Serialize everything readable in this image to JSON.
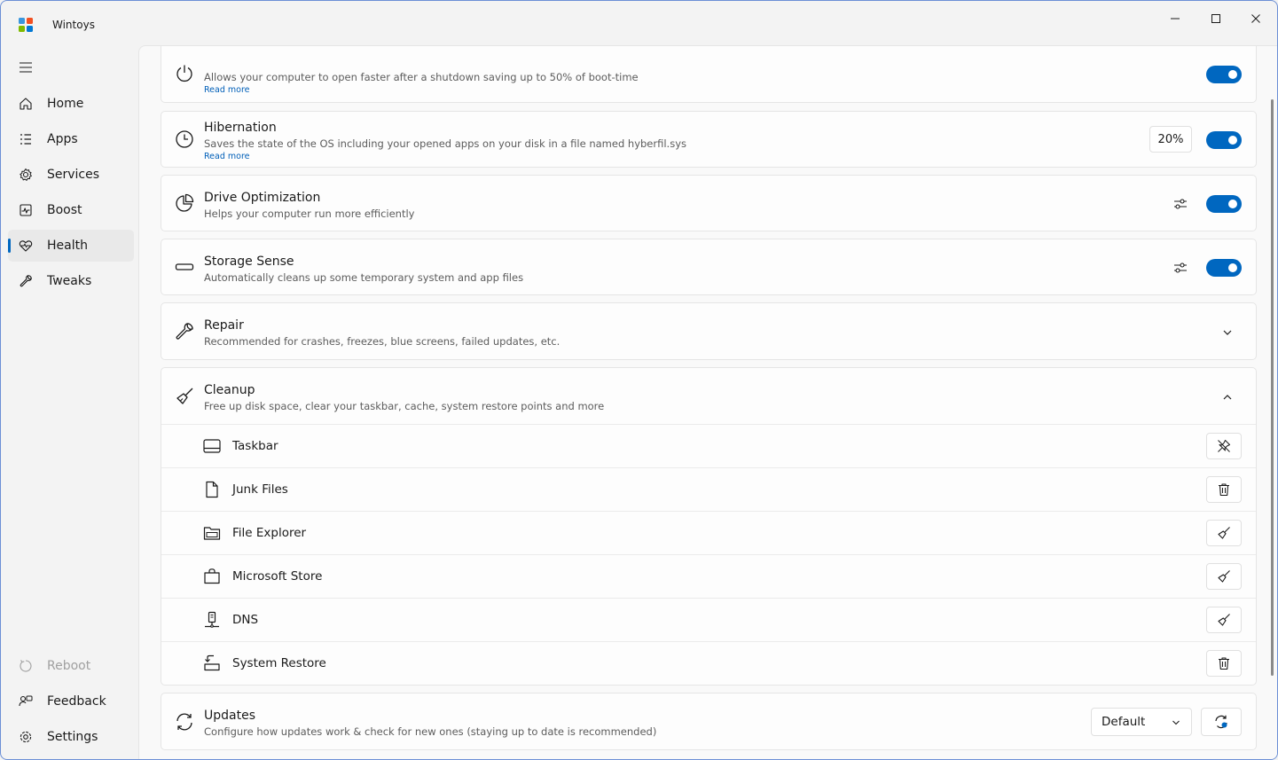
{
  "window": {
    "title": "Wintoys"
  },
  "sidebar": {
    "items": [
      {
        "label": "Home",
        "icon": "home-icon"
      },
      {
        "label": "Apps",
        "icon": "apps-list-icon"
      },
      {
        "label": "Services",
        "icon": "services-gear-icon"
      },
      {
        "label": "Boost",
        "icon": "boost-icon"
      },
      {
        "label": "Health",
        "icon": "health-heart-icon",
        "active": true
      },
      {
        "label": "Tweaks",
        "icon": "wrench-icon"
      }
    ],
    "footer": [
      {
        "label": "Reboot",
        "icon": "reboot-icon",
        "disabled": true
      },
      {
        "label": "Feedback",
        "icon": "feedback-icon"
      },
      {
        "label": "Settings",
        "icon": "settings-gear-icon"
      }
    ]
  },
  "cards": {
    "fast_startup": {
      "desc": "Allows your computer to open faster after a shutdown saving up to 50% of boot-time",
      "link": "Read more",
      "toggle_on": true
    },
    "hibernation": {
      "title": "Hibernation",
      "desc": "Saves the state of the OS including your opened apps on your disk in a file named hyberfil.sys",
      "link": "Read more",
      "percent": "20%",
      "toggle_on": true
    },
    "drive_optimization": {
      "title": "Drive Optimization",
      "desc": "Helps your computer run more efficiently",
      "toggle_on": true
    },
    "storage_sense": {
      "title": "Storage Sense",
      "desc": "Automatically cleans up some temporary system and app files",
      "toggle_on": true
    },
    "repair": {
      "title": "Repair",
      "desc": "Recommended for crashes, freezes, blue screens, failed updates, etc."
    },
    "cleanup": {
      "title": "Cleanup",
      "desc": "Free up disk space, clear your taskbar, cache, system restore points and more",
      "rows": [
        {
          "label": "Taskbar",
          "icon": "taskbar-icon",
          "action_icon": "unpin-icon"
        },
        {
          "label": "Junk Files",
          "icon": "file-icon",
          "action_icon": "trash-icon"
        },
        {
          "label": "File Explorer",
          "icon": "folder-icon",
          "action_icon": "broom-icon"
        },
        {
          "label": "Microsoft Store",
          "icon": "store-bag-icon",
          "action_icon": "broom-icon"
        },
        {
          "label": "DNS",
          "icon": "server-icon",
          "action_icon": "broom-icon"
        },
        {
          "label": "System Restore",
          "icon": "restore-icon",
          "action_icon": "trash-icon"
        }
      ]
    },
    "updates": {
      "title": "Updates",
      "desc": "Configure how updates work & check for new ones (staying up to date is recommended)",
      "dropdown_value": "Default"
    }
  },
  "colors": {
    "accent": "#0067c0",
    "link": "#005fb8"
  }
}
